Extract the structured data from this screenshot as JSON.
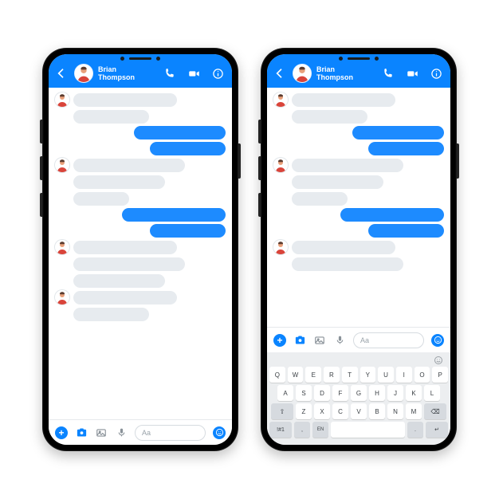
{
  "contact": {
    "first": "Brian",
    "last": "Thompson"
  },
  "composer": {
    "placeholder": "Aa"
  },
  "colors": {
    "accent": "#0a84ff",
    "bubble_in": "#e7ebef",
    "bubble_out": "#1d8bff"
  },
  "messages": [
    {
      "side": "in",
      "w": "w4",
      "avatar": true
    },
    {
      "side": "in",
      "w": "w2",
      "avatar": false
    },
    {
      "side": "out",
      "w": "w3"
    },
    {
      "side": "out",
      "w": "w2"
    },
    {
      "side": "in",
      "w": "w5",
      "avatar": true
    },
    {
      "side": "in",
      "w": "w3",
      "avatar": false
    },
    {
      "side": "in",
      "w": "w1",
      "avatar": false
    },
    {
      "side": "out",
      "w": "w4"
    },
    {
      "side": "out",
      "w": "w2"
    },
    {
      "side": "in",
      "w": "w4",
      "avatar": true
    },
    {
      "side": "in",
      "w": "w5",
      "avatar": false
    },
    {
      "side": "in",
      "w": "w3",
      "avatar": false
    },
    {
      "side": "in",
      "w": "w4",
      "avatar": true
    },
    {
      "side": "in",
      "w": "w2",
      "avatar": false
    }
  ],
  "keyboard": {
    "row1": [
      "Q",
      "W",
      "E",
      "R",
      "T",
      "Y",
      "U",
      "I",
      "O",
      "P"
    ],
    "row2": [
      "A",
      "S",
      "D",
      "F",
      "G",
      "H",
      "J",
      "K",
      "L"
    ],
    "row3_letters": [
      "Z",
      "X",
      "C",
      "V",
      "B",
      "N",
      "M"
    ],
    "shift": "⇧",
    "backspace": "⌫",
    "sym": "!#1",
    "comma": ",",
    "lang": "EN",
    "period": ".",
    "enter": "↵"
  }
}
